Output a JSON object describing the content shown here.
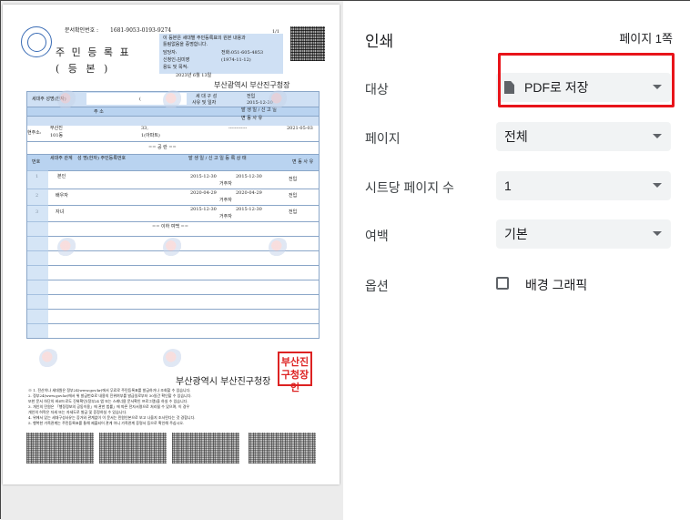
{
  "document": {
    "issue_no_label": "문서확인번호 :",
    "issue_no": "1681-9053-0193-9274",
    "page_frac": "1/1",
    "title": "주 민 등 록 표",
    "subtitle": "( 등 본 )",
    "notice_line1": "이 등본은 세대별 주민등록표의 원본 내용과",
    "notice_line2": "틀림없음을 증명합니다.",
    "manager_label": "담당자:",
    "phone": "전화:051-605-4853",
    "applicant_label": "신청인:김미영",
    "applicant_date": "(1974-11-12)",
    "purpose_label": "용도 및 목적:",
    "issue_date": "2023년 6월 13일",
    "issuer_header": "부산광역시 부산진구청장",
    "head_label": "세대주 성명(한자)",
    "head_name": "(",
    "composition_label": "세 대 구 성",
    "composition_sub": "사유 및 일자",
    "transfer_label": "전입",
    "transfer_date": "2015-12-30",
    "address_col": "주 소",
    "occur_col": "발 생 일 / 신 고 일",
    "change_col": "변 동 사 유",
    "current_addr_label": "현주소:",
    "current_addr": "부산진",
    "addr_detail": "33,",
    "apt": "101동",
    "apt_detail": "1(아파트)",
    "addr_date": "2021-05-03",
    "addr_dash": "------------",
    "share_label": "== 공 란 ==",
    "member_cols": [
      "번호",
      "세대주 관계",
      "성 명(한자) 주민등록번호",
      "발 생 일 / 신 고 일 등 록 상 태",
      "변 동 사 유"
    ],
    "members": [
      {
        "no": "1",
        "rel": "본인",
        "date1": "2015-12-30",
        "date2": "2015-12-30",
        "status": "거주자",
        "reason": "전입"
      },
      {
        "no": "2",
        "rel": "배우자",
        "date1": "2020-04-29",
        "date2": "2020-04-29",
        "status": "거주자",
        "reason": "전입"
      },
      {
        "no": "3",
        "rel": "자녀",
        "date1": "2015-12-30",
        "date2": "2015-12-30",
        "status": "거주자",
        "reason": "전입"
      }
    ],
    "end_mark": "== 이하 여백 ==",
    "footer_issuer": "부산광역시 부산진구청장",
    "stamp_text": "부산진구청장인",
    "foot_notes": [
      "※ 1. 전산이나 세대원은 정부24(www.gov.kr)에서 무료로 주민등록표를 발급하거나 조회할 수 있습니다.",
      "2. 정부24(www.gov.kr)에서 위 발급번호로 내용의 진위여부를 발급일로부터 30일간 확인할 수 있습니다.",
      "또한 문서 하단의 바코드로도 진위확인(정부24 앱 또는 스캐너용 문서확인 프로그램)을 하실 수 있습니다.",
      "3. 개인의 민원은 「행정정보의 공동이용」에 관한 법률」에 따른 전자서명으로 처리될 수 있으며, 이 경우",
      "개인의 허락은 자세 또는 자세도로 발급 및 증정하실 수 있습니다.",
      "4. 위에서 있는 세대구성사유는 증거와 관계없이 이 문서는 민원인본으로 보고 나을지 조사된다는 것 경합니다.",
      "5. 행복한 가족관계는 주민등록표를 통해 제출되어 관계 아니 가족관계 증명서 등으로 확인해 주십시오."
    ]
  },
  "settings": {
    "title": "인쇄",
    "page_count": "페이지 1쪽",
    "rows": [
      {
        "label": "대상",
        "value": "PDF로 저장"
      },
      {
        "label": "페이지",
        "value": "전체"
      },
      {
        "label": "시트당 페이지 수",
        "value": "1"
      },
      {
        "label": "여백",
        "value": "기본"
      },
      {
        "label": "옵션",
        "checkbox_label": "배경 그래픽"
      }
    ],
    "highlight_color": "#e8141a"
  }
}
